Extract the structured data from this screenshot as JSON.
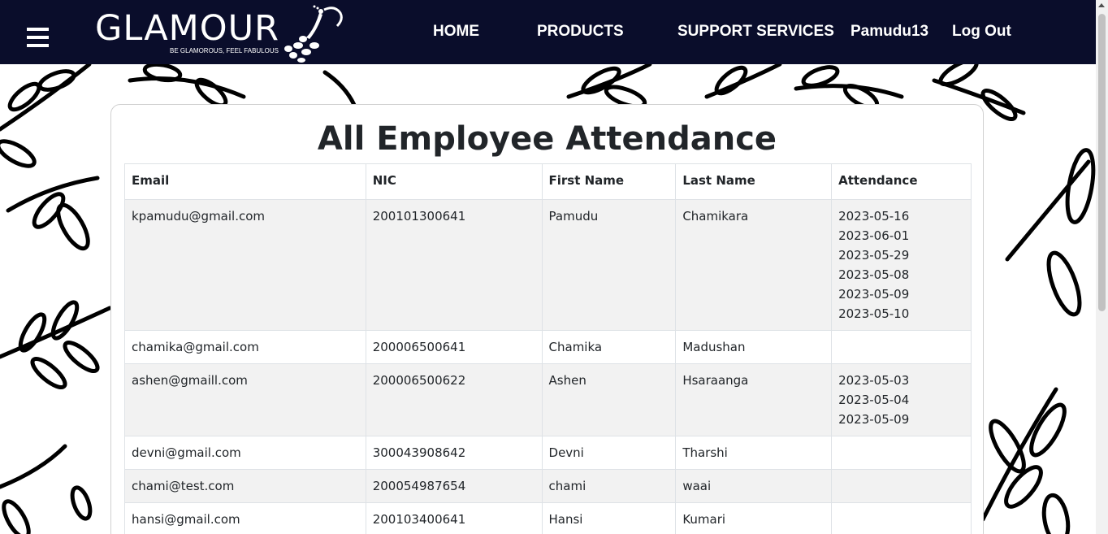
{
  "brand": {
    "name": "GLAMOUR",
    "tagline": "BE GLAMOROUS, FEEL FABULOUS"
  },
  "nav": {
    "home": "HOME",
    "products": "PRODUCTS",
    "support": "SUPPORT SERVICES",
    "user": "Pamudu13",
    "logout": "Log Out"
  },
  "page": {
    "title": "All Employee Attendance"
  },
  "table": {
    "headers": [
      "Email",
      "NIC",
      "First Name",
      "Last Name",
      "Attendance"
    ],
    "rows": [
      {
        "email": "kpamudu@gmail.com",
        "nic": "200101300641",
        "first": "Pamudu",
        "last": "Chamikara",
        "attendance": [
          "2023-05-16",
          "2023-06-01",
          "2023-05-29",
          "2023-05-08",
          "2023-05-09",
          "2023-05-10"
        ]
      },
      {
        "email": "chamika@gmail.com",
        "nic": "200006500641",
        "first": "Chamika",
        "last": "Madushan",
        "attendance": []
      },
      {
        "email": "ashen@gmaill.com",
        "nic": "200006500622",
        "first": "Ashen",
        "last": "Hsaraanga",
        "attendance": [
          "2023-05-03",
          "2023-05-04",
          "2023-05-09"
        ]
      },
      {
        "email": "devni@gmail.com",
        "nic": "300043908642",
        "first": "Devni",
        "last": "Tharshi",
        "attendance": []
      },
      {
        "email": "chami@test.com",
        "nic": "200054987654",
        "first": "chami",
        "last": "waai",
        "attendance": []
      },
      {
        "email": "hansi@gmail.com",
        "nic": "200103400641",
        "first": "Hansi",
        "last": "Kumari",
        "attendance": []
      }
    ]
  },
  "colors": {
    "header_bg": "#0a0d2b",
    "row_stripe": "#f2f2f2"
  }
}
